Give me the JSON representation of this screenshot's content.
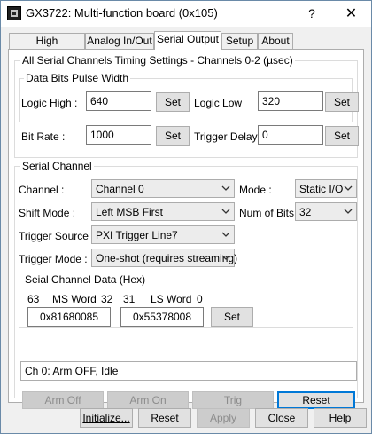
{
  "window": {
    "title": "GX3722: Multi-function board (0x105)",
    "help_glyph": "?",
    "close_glyph": "✕"
  },
  "tabs": [
    {
      "label": "High Bandwidth"
    },
    {
      "label": "Analog In/Out"
    },
    {
      "label": "Serial Output"
    },
    {
      "label": "Setup"
    },
    {
      "label": "About"
    }
  ],
  "timing": {
    "group_title": "All Serial Channels Timing Settings - Channels 0-2  (µsec)",
    "pulse_group_title": "Data Bits Pulse Width",
    "logic_high_label": "Logic High :",
    "logic_high_value": "640",
    "logic_low_label": "Logic Low",
    "logic_low_value": "320",
    "bit_rate_label": "Bit Rate :",
    "bit_rate_value": "1000",
    "trigger_delay_label": "Trigger Delay :",
    "trigger_delay_value": "0",
    "set_label": "Set"
  },
  "channel": {
    "group_title": "Serial Channel",
    "channel_label": "Channel :",
    "channel_value": "Channel 0",
    "mode_label": "Mode :",
    "mode_value": "Static I/O",
    "shift_mode_label": "Shift Mode :",
    "shift_mode_value": "Left MSB First",
    "num_bits_label": "Num of Bits :",
    "num_bits_value": "32",
    "trigger_source_label": "Trigger Source :",
    "trigger_source_value": "PXI Trigger Line7",
    "trigger_mode_label": "Trigger Mode :",
    "trigger_mode_value": "One-shot (requires streaming)",
    "data_group_title": "Seial Channel Data (Hex)",
    "bit63": "63",
    "ms_word_label": "MS Word",
    "bit32": "32",
    "bit31": "31",
    "ls_word_label": "LS Word",
    "bit0": "0",
    "ms_word_value": "0x81680085",
    "ls_word_value": "0x55378008",
    "set_label": "Set"
  },
  "actions": {
    "arm_off": "Arm Off",
    "arm_on": "Arm On",
    "trig": "Trig",
    "reset": "Reset",
    "status": "Ch 0: Arm OFF, Idle"
  },
  "footer": {
    "initialize": "Initialize...",
    "reset": "Reset",
    "apply": "Apply",
    "close": "Close",
    "help": "Help"
  }
}
